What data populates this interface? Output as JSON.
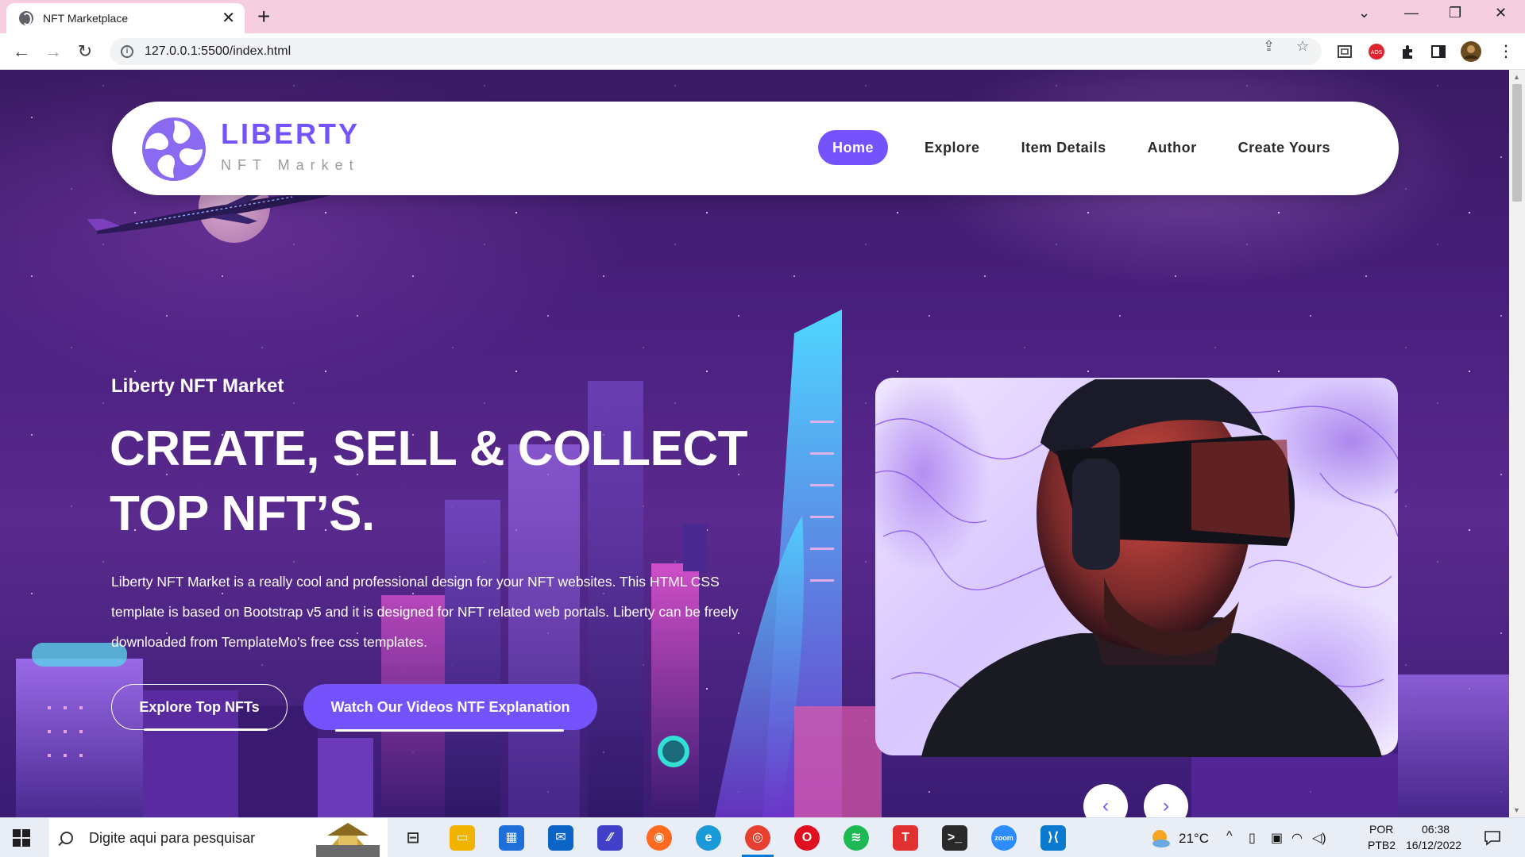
{
  "browser": {
    "tab_title": "NFT Marketplace",
    "tab_close": "✕",
    "new_tab": "+",
    "url": "127.0.0.1:5500/index.html",
    "window_controls": [
      "⌄",
      "—",
      "❐",
      "✕"
    ]
  },
  "nav": {
    "logo_title": "LIBERTY",
    "logo_subtitle": "NFT Market",
    "items": [
      {
        "label": "Home",
        "active": true
      },
      {
        "label": "Explore",
        "active": false
      },
      {
        "label": "Item Details",
        "active": false
      },
      {
        "label": "Author",
        "active": false
      },
      {
        "label": "Create Yours",
        "active": false
      }
    ]
  },
  "hero": {
    "eyebrow": "Liberty NFT Market",
    "headline_line1": "CREATE, SELL & COLLECT",
    "headline_line2": "TOP NFT’S.",
    "description": "Liberty NFT Market is a really cool and professional design for your NFT websites. This HTML CSS template is based on Bootstrap v5 and it is designed for NFT related web portals. Liberty can be freely downloaded from TemplateMo's free css templates.",
    "btn_explore": "Explore Top NFTs",
    "btn_watch": "Watch Our Videos NTF Explanation",
    "prev_arrow": "‹",
    "next_arrow": "›"
  },
  "taskbar": {
    "search_placeholder": "Digite aqui para pesquisar",
    "weather": "21°C",
    "language_line1": "POR",
    "language_line2": "PTB2",
    "time": "06:38",
    "date": "16/12/2022"
  },
  "colors": {
    "accent": "#7453fc",
    "tabbar": "#f5cfdf",
    "page_bg": "#4a2080"
  }
}
